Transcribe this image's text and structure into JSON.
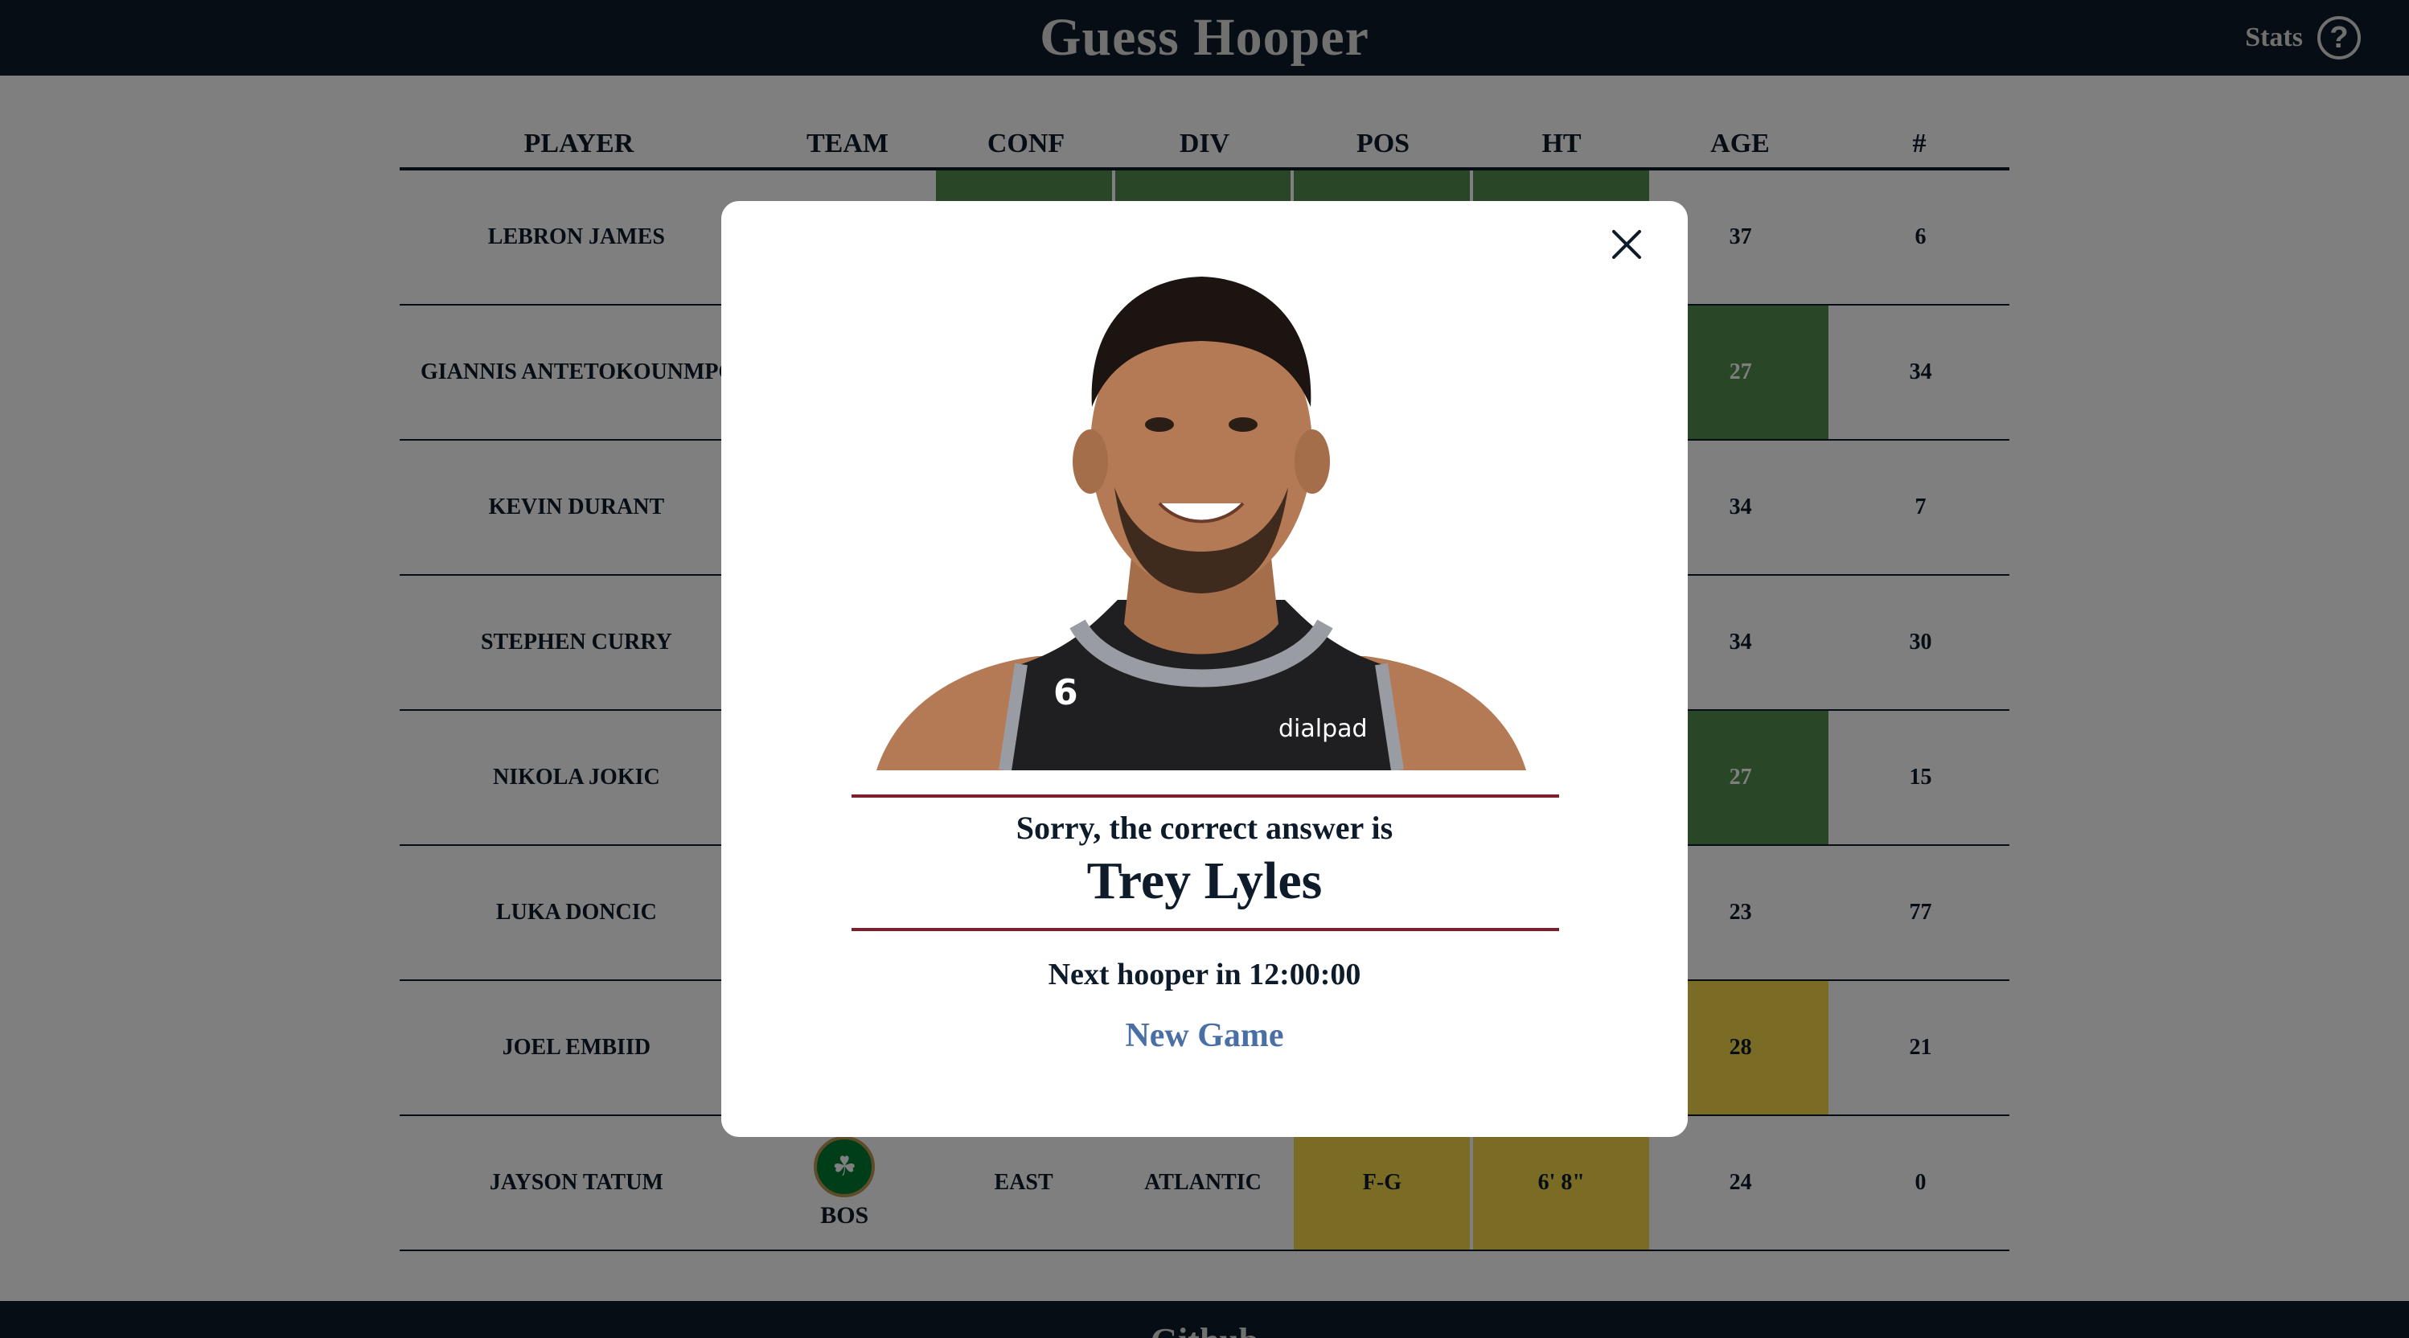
{
  "app": {
    "title": "Guess Hooper",
    "stats_label": "Stats",
    "help_icon": "question-circle-icon",
    "footer_link": "Github"
  },
  "colors": {
    "header_bg": "#0d1b2a",
    "correct": "#538d4e",
    "close": "#f5d94a",
    "accent_rule": "#7a1f2b",
    "link": "#4a6fa5"
  },
  "table": {
    "headers": [
      "PLAYER",
      "TEAM",
      "CONF",
      "DIV",
      "POS",
      "HT",
      "AGE",
      "#"
    ],
    "rows": [
      {
        "player": "LEBRON JAMES",
        "age": "37",
        "num": "6",
        "age_status": "none"
      },
      {
        "player": "GIANNIS ANTETOKOUNMPO",
        "age": "27",
        "num": "34",
        "age_status": "correct"
      },
      {
        "player": "KEVIN DURANT",
        "age": "34",
        "num": "7",
        "age_status": "none"
      },
      {
        "player": "STEPHEN CURRY",
        "age": "34",
        "num": "30",
        "age_status": "none"
      },
      {
        "player": "NIKOLA JOKIC",
        "age": "27",
        "num": "15",
        "age_status": "correct"
      },
      {
        "player": "LUKA DONCIC",
        "age": "23",
        "num": "77",
        "age_status": "none"
      },
      {
        "player": "JOEL EMBIID",
        "age": "28",
        "num": "21",
        "age_status": "close"
      },
      {
        "player": "JAYSON TATUM",
        "team": "BOS",
        "team_logo": "celtics-logo",
        "conf": "EAST",
        "div": "ATLANTIC",
        "pos": "F-G",
        "ht": "6' 8\"",
        "age": "24",
        "num": "0",
        "age_status": "none"
      }
    ]
  },
  "modal": {
    "close_icon": "close-icon",
    "photo": "player-headshot",
    "sorry_text": "Sorry, the correct answer is",
    "answer": "Trey Lyles",
    "next_text": "Next hooper in 12:00:00",
    "new_game_label": "New Game"
  }
}
